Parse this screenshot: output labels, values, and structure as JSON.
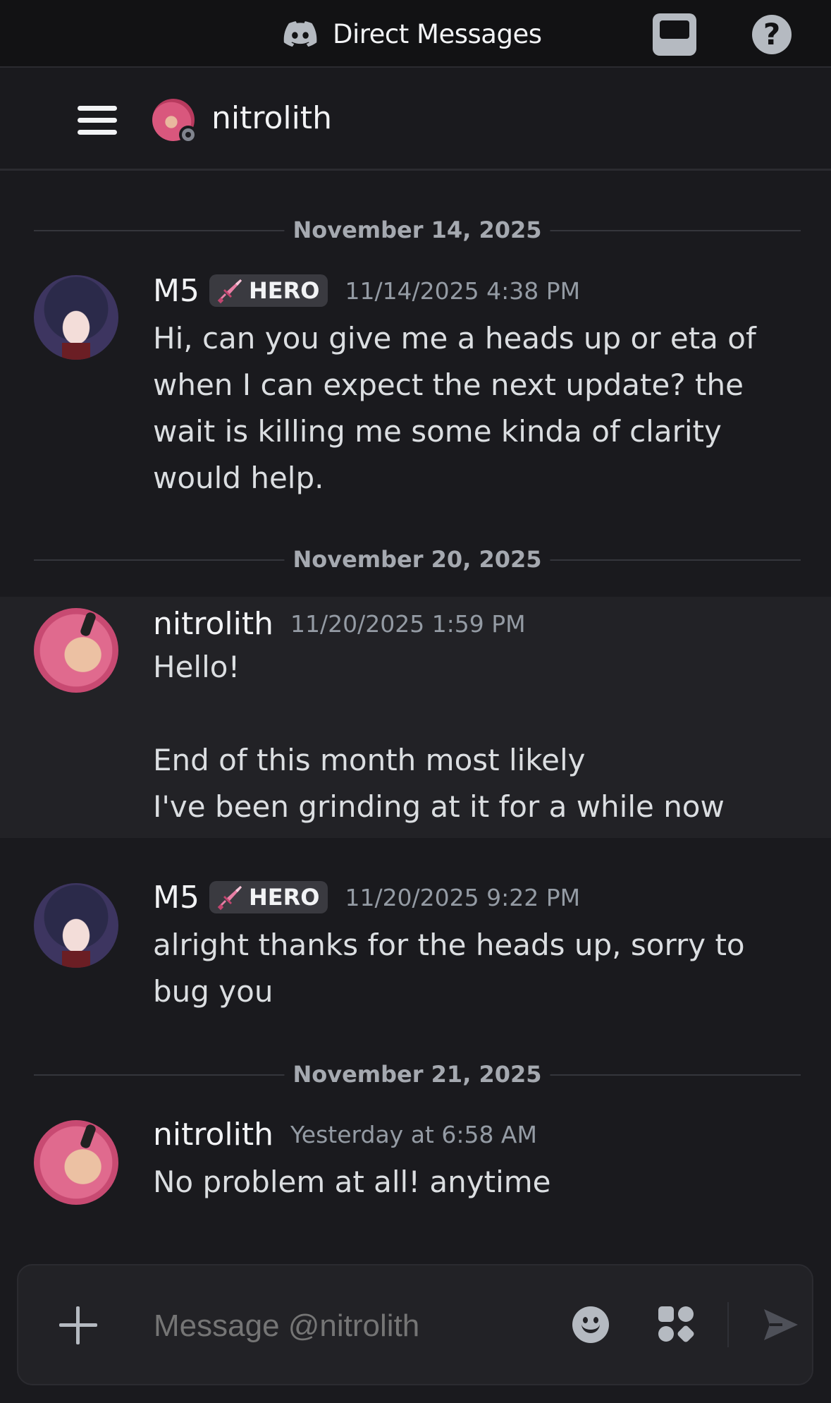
{
  "topbar": {
    "title": "Direct Messages",
    "logo_icon": "discord-logo-icon",
    "inbox_icon": "inbox-icon",
    "help_icon": "help-icon",
    "help_glyph": "?"
  },
  "channel": {
    "name": "nitrolith",
    "status": "offline"
  },
  "dates": {
    "d1": "November 14, 2025",
    "d2": "November 20, 2025",
    "d3": "November 21, 2025"
  },
  "messages": [
    {
      "author": "M5",
      "badge": "HERO",
      "time": "11/14/2025 4:38 PM",
      "text": "Hi, can you give me a heads up or eta of when I can expect the next update? the wait is killing me some kinda of clarity would help."
    },
    {
      "author": "nitrolith",
      "time": "11/20/2025 1:59 PM",
      "text": "Hello!\n\nEnd of this month most likely\nI've been grinding at it for a while now"
    },
    {
      "author": "M5",
      "badge": "HERO",
      "time": "11/20/2025 9:22 PM",
      "text": "alright thanks for the heads up, sorry to bug you"
    },
    {
      "author": "nitrolith",
      "time": "Yesterday at 6:58 AM",
      "text": "No problem at all! anytime"
    }
  ],
  "composer": {
    "placeholder": "Message @nitrolith",
    "icons": [
      "plus-icon",
      "emoji-icon",
      "apps-icon",
      "send-icon"
    ]
  },
  "colors": {
    "background": "#1a1a1e",
    "topbar": "#121214",
    "highlight_row": "#222226",
    "timestamp": "#949ba4",
    "badge_bg": "#3a3a40",
    "sword_pink": "#e87fa5"
  }
}
